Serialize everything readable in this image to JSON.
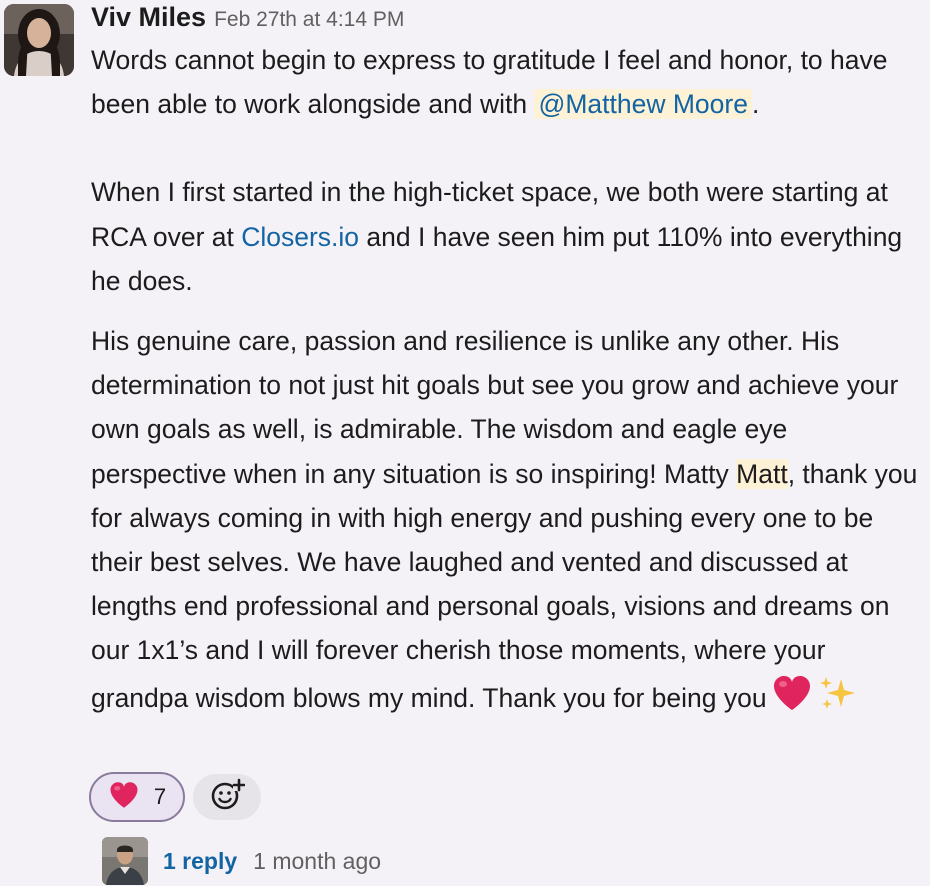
{
  "message": {
    "sender": "Viv Miles",
    "timestamp": "Feb 27th at 4:14 PM",
    "p1": {
      "a": "Words cannot begin to express to gratitude I feel and honor, to have been able to work alongside and with ",
      "mention": "@Matthew Moore",
      "b": "."
    },
    "p2": {
      "a": "When I first started in the high-ticket space, we both were starting at RCA over at ",
      "link": "Closers.io",
      "b": " and I have seen him put 110% into everything he does."
    },
    "p3": {
      "a": "His genuine care, passion and resilience is unlike any other. His determination to not just hit goals but see you grow and achieve your own goals as well, is admirable. The wisdom and eagle eye perspective when in any situation is so inspiring! Matty ",
      "highlight": "Matt",
      "b": ", thank you for always coming in with high energy and pushing every one to be their best selves. We have laughed and vented and discussed at lengths end professional and personal goals, visions and dreams on our 1x1’s and I will forever cherish those moments, where your grandpa wisdom blows my mind. Thank you for being you",
      "emojis": [
        "heart-emoji",
        "sparkles-emoji"
      ]
    }
  },
  "reactions": [
    {
      "emoji": "heart-emoji",
      "count": "7"
    }
  ],
  "add_reaction_icon": "add-reaction-icon",
  "thread": {
    "reply_count": "1 reply",
    "last_reply": "1 month ago"
  },
  "colors": {
    "background": "#f4f2f7",
    "link": "#1264a3",
    "mention_bg": "#fdf1d6",
    "reaction_bg": "#e9e3f2",
    "reaction_border": "#8a7a9c",
    "heart": "#e0245e",
    "sparkle": "#f5c542"
  }
}
